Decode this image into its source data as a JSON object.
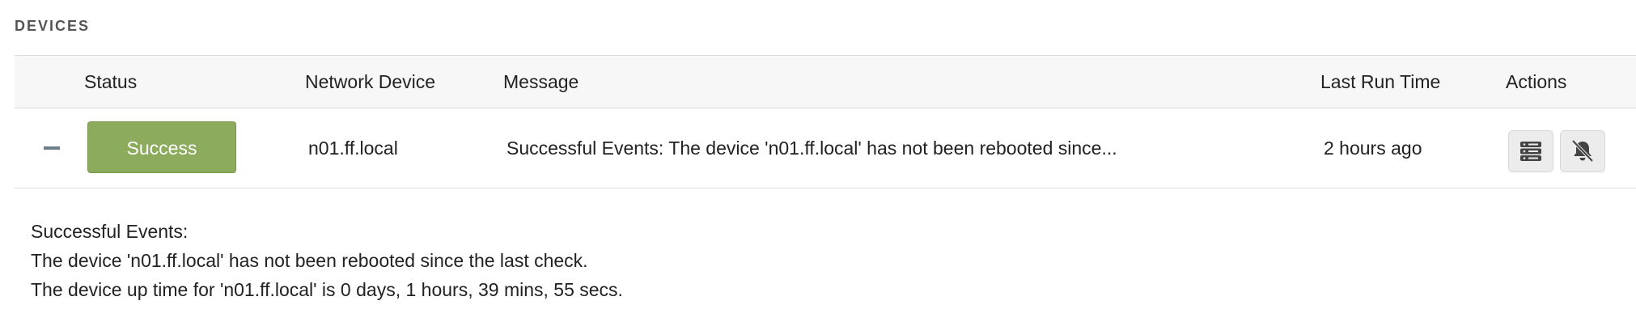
{
  "section": {
    "title": "DEVICES"
  },
  "table": {
    "columns": [
      "Status",
      "Network Device",
      "Message",
      "Last Run Time",
      "Actions"
    ],
    "rows": [
      {
        "status": "Success",
        "device": "n01.ff.local",
        "message": "Successful Events: The device 'n01.ff.local' has not been rebooted since...",
        "last_run": "2 hours ago",
        "actions": [
          "server-icon",
          "bell-off-icon"
        ]
      }
    ]
  },
  "details": {
    "lines": [
      "Successful Events:",
      "The device 'n01.ff.local' has not been rebooted since the last check.",
      "The device up time for 'n01.ff.local' is 0 days, 1 hours, 39 mins, 55 secs."
    ]
  },
  "colors": {
    "success": "#8cab5d",
    "header_bg": "#f7f7f7",
    "collapse": "#6e7d8c"
  }
}
